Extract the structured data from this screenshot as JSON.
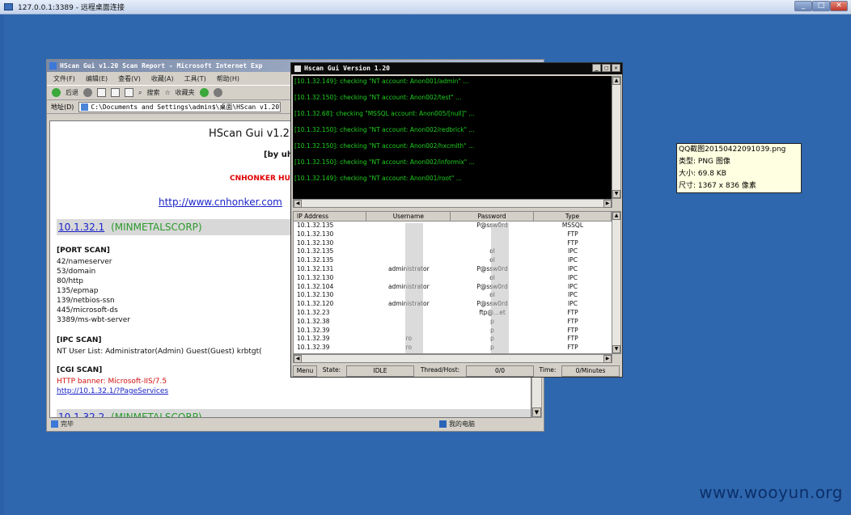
{
  "rdp": {
    "title": "127.0.0.1:3389 - 远程桌面连接"
  },
  "watermark": "www.wooyun.org",
  "ie": {
    "title": "HScan Gui v1.20 Scan Report - Microsoft Internet Exp",
    "menu": [
      "文件(F)",
      "编辑(E)",
      "查看(V)",
      "收藏(A)",
      "工具(T)",
      "帮助(H)"
    ],
    "toolbar": {
      "back": "后退",
      "search": "搜索",
      "favorites": "收藏夹"
    },
    "address_label": "地址(D)",
    "address": "C:\\Documents and Settings\\admin$\\桌面\\HScan v1.20\\HS",
    "status_done": "完毕",
    "status_zone": "我的电脑"
  },
  "report": {
    "title": "HScan Gui v1.2",
    "by": "[by uh",
    "team": "CNHONKER HU",
    "url": "http://www.cnhonker.com",
    "host1_ip": "10.1.32.1",
    "host1_name": "(MINMETALSCORP)",
    "port_scan_heading": "[PORT SCAN]",
    "ports": [
      "42/nameserver",
      "53/domain",
      "80/http",
      "135/epmap",
      "139/netbios-ssn",
      "445/microsoft-ds",
      "3389/ms-wbt-server"
    ],
    "ipc_heading": "[IPC SCAN]",
    "ipc_users": "NT User List: Administrator(Admin) Guest(Guest) krbtgt(",
    "cgi_heading": "[CGI SCAN]",
    "cgi_banner": "HTTP banner: Microsoft-IIS/7.5",
    "cgi_link": "http://10.1.32.1/?PageServices",
    "host2_ip": "10.1.32.2",
    "host2_name": "(MINMETALSCORP)"
  },
  "hscan": {
    "title": "Hscan Gui Version 1.20",
    "log": [
      "[10.1.32.149]: checking \"NT account: Anon001/admin\" ...",
      "[10.1.32.150]: checking \"NT account: Anon002/test\" ...",
      "[10.1.32.68]: checking \"MSSQL account: Anon005/[null]\" ...",
      "[10.1.32.150]: checking \"NT account: Anon002/redbrick\" ...",
      "[10.1.32.150]: checking \"NT account: Anon002/hxcmith\" ...",
      "[10.1.32.150]: checking \"NT account: Anon002/informix\" ...",
      "[10.1.32.149]: checking \"NT account: Anon001/root\" ..."
    ],
    "columns": [
      "IP Address",
      "Username",
      "Password",
      "Type"
    ],
    "rows": [
      [
        "10.1.32.135",
        "",
        "P@ssw0rd",
        "MSSQL"
      ],
      [
        "10.1.32.130",
        "",
        "",
        "FTP"
      ],
      [
        "10.1.32.130",
        "",
        "",
        "FTP"
      ],
      [
        "10.1.32.135",
        "",
        "ol",
        "IPC"
      ],
      [
        "10.1.32.135",
        "",
        "ol",
        "IPC"
      ],
      [
        "10.1.32.131",
        "administrator",
        "P@ssw0rd",
        "IPC"
      ],
      [
        "10.1.32.130",
        "",
        "ol",
        "IPC"
      ],
      [
        "10.1.32.104",
        "administrator",
        "P@ssw0rd",
        "IPC"
      ],
      [
        "10.1.32.130",
        "",
        "ol",
        "IPC"
      ],
      [
        "10.1.32.120",
        "administrator",
        "P@ssw0rd",
        "IPC"
      ],
      [
        "10.1.32.23",
        "",
        "ftp@...et",
        "FTP"
      ],
      [
        "10.1.32.38",
        "",
        "p",
        "FTP"
      ],
      [
        "10.1.32.39",
        "",
        "p",
        "FTP"
      ],
      [
        "10.1.32.39",
        "ro",
        "p",
        "FTP"
      ],
      [
        "10.1.32.39",
        "ro",
        "p",
        "FTP"
      ]
    ],
    "status": {
      "menu": "Menu",
      "state_label": "State:",
      "state": "IDLE",
      "thread_label": "Thread/Host:",
      "thread": "0/0",
      "time_label": "Time:",
      "time": "0/Minutes"
    }
  },
  "tooltip": {
    "name": "QQ截图20150422091039.png",
    "type": "类型: PNG 图像",
    "size": "大小: 69.8 KB",
    "dims": "尺寸: 1367 x 836 像素"
  }
}
